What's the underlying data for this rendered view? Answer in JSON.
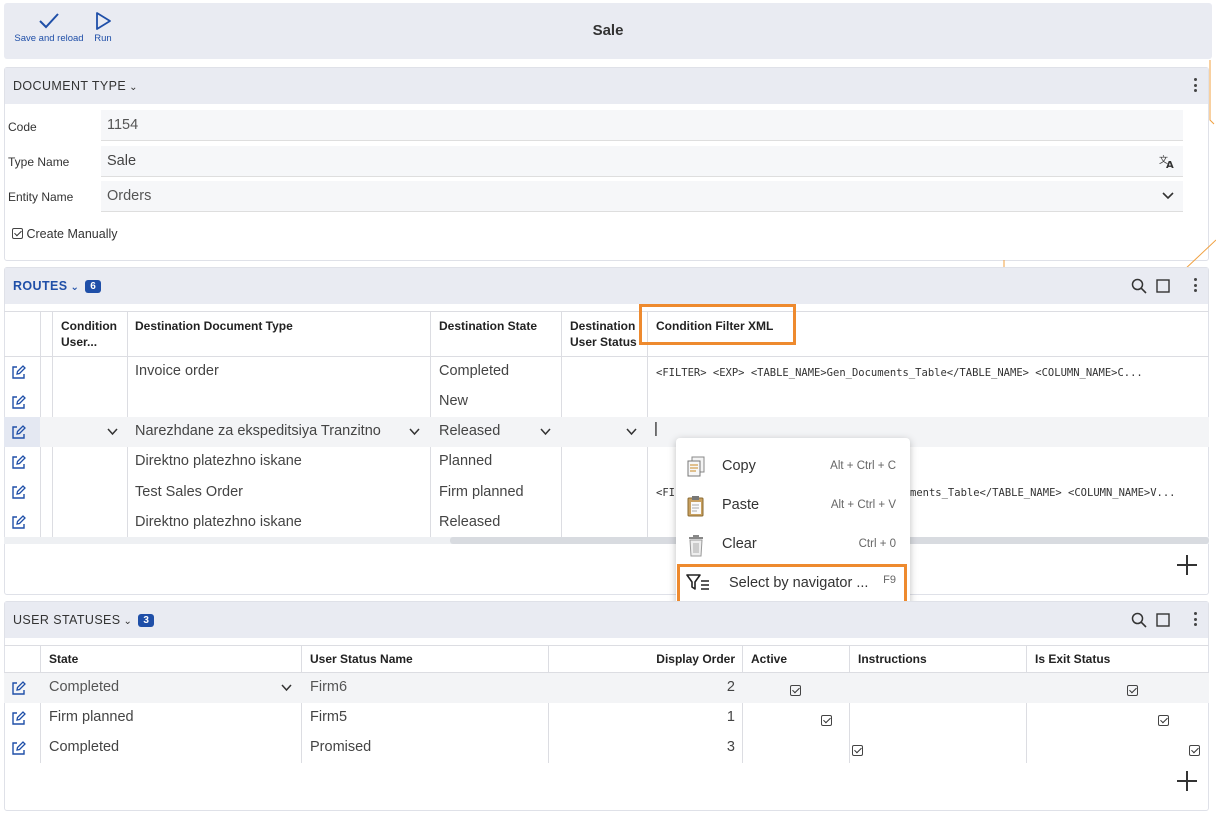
{
  "toolbar": {
    "save_label": "Save and reload",
    "run_label": "Run",
    "title": "Sale"
  },
  "document_type": {
    "header": "DOCUMENT TYPE",
    "fields": {
      "code_label": "Code",
      "code_value": "1154",
      "type_name_label": "Type Name",
      "type_name_value": "Sale",
      "entity_name_label": "Entity Name",
      "entity_name_value": "Orders",
      "create_manually_label": "Create Manually"
    }
  },
  "routes": {
    "header": "ROUTES",
    "count": "6",
    "columns": {
      "c1": "Condition User...",
      "c2": "Destination Document Type",
      "c3": "Destination State",
      "c4": "Destination User Status",
      "c5": "Condition Filter XML"
    },
    "rows": [
      {
        "doc_type": "Invoice order",
        "state": "Completed",
        "xml": "<FILTER> <EXP> <TABLE_NAME>Gen_Documents_Table</TABLE_NAME> <COLUMN_NAME>C..."
      },
      {
        "doc_type": "",
        "state": "New",
        "xml": ""
      },
      {
        "doc_type": "Narezhdane za ekspeditsiya Tranzitno",
        "state": "Released",
        "xml": "|"
      },
      {
        "doc_type": "Direktno platezhno iskane",
        "state": "Planned",
        "xml": ""
      },
      {
        "doc_type": "Test Sales Order",
        "state": "Firm planned",
        "xml_left": "<FI",
        "xml_right": "ments_Table</TABLE_NAME> <COLUMN_NAME>V..."
      },
      {
        "doc_type": "Direktno platezhno iskane",
        "state": "Released",
        "xml": ""
      }
    ]
  },
  "context_menu": {
    "items": [
      {
        "label": "Copy",
        "shortcut": "Alt + Ctrl + C",
        "icon": "copy-icon"
      },
      {
        "label": "Paste",
        "shortcut": "Alt + Ctrl + V",
        "icon": "paste-icon"
      },
      {
        "label": "Clear",
        "shortcut": "Ctrl + 0",
        "icon": "trash-icon"
      },
      {
        "label": "Select by navigator ...",
        "shortcut": "F9",
        "icon": "filter-list-icon"
      }
    ]
  },
  "user_statuses": {
    "header": "USER STATUSES",
    "count": "3",
    "columns": {
      "state": "State",
      "name": "User Status Name",
      "order": "Display Order",
      "active": "Active",
      "instructions": "Instructions",
      "exit": "Is Exit Status"
    },
    "rows": [
      {
        "state": "Completed",
        "name": "Firm6",
        "order": "2",
        "active": true,
        "instructions": "",
        "exit": true
      },
      {
        "state": "Firm planned",
        "name": "Firm5",
        "order": "1",
        "active": true,
        "instructions": "",
        "exit": true
      },
      {
        "state": "Completed",
        "name": "Promised",
        "order": "3",
        "active": true,
        "instructions": "",
        "exit": true
      }
    ]
  },
  "colors": {
    "accent": "#1f4fa8",
    "highlight": "#ee8a2e",
    "panel_header": "#e9ebf2"
  }
}
